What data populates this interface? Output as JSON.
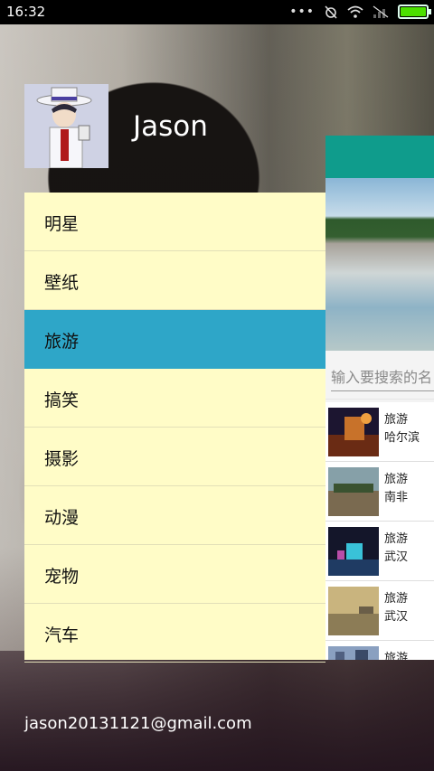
{
  "status_bar": {
    "time": "16:32",
    "battery_level": 1.0,
    "battery_color": "#4be000"
  },
  "drawer": {
    "user_name": "Jason",
    "email": "jason20131121@gmail.com",
    "menu_items": [
      {
        "label": "明星"
      },
      {
        "label": "壁纸"
      },
      {
        "label": "旅游",
        "selected": true
      },
      {
        "label": "搞笑"
      },
      {
        "label": "摄影"
      },
      {
        "label": "动漫"
      },
      {
        "label": "宠物"
      },
      {
        "label": "汽车"
      }
    ],
    "accent_color": "#2ea6c8",
    "background_color": "#fffcc7"
  },
  "content": {
    "toolbar_color": "#0f9c8c",
    "search": {
      "placeholder": "输入要搜索的名"
    },
    "list": [
      {
        "category": "旅游",
        "city": "哈尔滨"
      },
      {
        "category": "旅游",
        "city": "南非"
      },
      {
        "category": "旅游",
        "city": "武汉"
      },
      {
        "category": "旅游",
        "city": "武汉"
      },
      {
        "category": "旅游",
        "city": ""
      }
    ]
  }
}
